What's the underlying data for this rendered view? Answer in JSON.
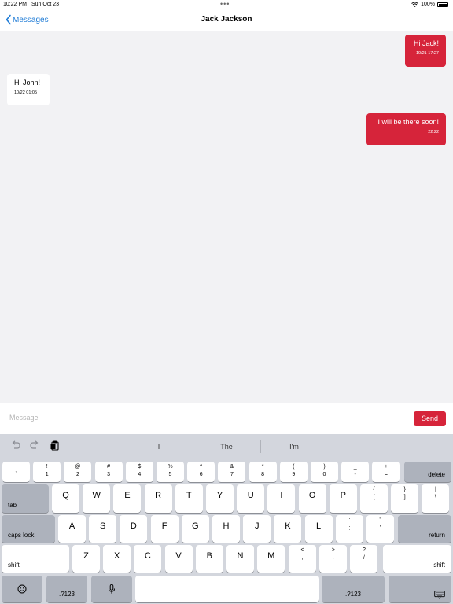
{
  "status_bar": {
    "time": "10:22 PM",
    "date": "Sun Oct 23",
    "dots": "•••",
    "battery": "100%"
  },
  "nav": {
    "back_label": "Messages",
    "title": "Jack Jackson"
  },
  "messages": [
    {
      "direction": "outgoing",
      "text": "Hi Jack!",
      "timestamp": "10/21 17:27"
    },
    {
      "direction": "incoming",
      "text": "Hi John!",
      "timestamp": "10/22 01:05"
    },
    {
      "direction": "outgoing",
      "text": "I will be there soon!",
      "timestamp": "22:22"
    }
  ],
  "composer": {
    "placeholder": "Message",
    "send_label": "Send"
  },
  "keyboard": {
    "suggestions": [
      "I",
      "The",
      "I'm"
    ],
    "number_row": [
      {
        "top": "~",
        "bottom": "`"
      },
      {
        "top": "!",
        "bottom": "1"
      },
      {
        "top": "@",
        "bottom": "2"
      },
      {
        "top": "#",
        "bottom": "3"
      },
      {
        "top": "$",
        "bottom": "4"
      },
      {
        "top": "%",
        "bottom": "5"
      },
      {
        "top": "^",
        "bottom": "6"
      },
      {
        "top": "&",
        "bottom": "7"
      },
      {
        "top": "*",
        "bottom": "8"
      },
      {
        "top": "(",
        "bottom": "9"
      },
      {
        "top": ")",
        "bottom": "0"
      },
      {
        "top": "_",
        "bottom": "-"
      },
      {
        "top": "+",
        "bottom": "="
      }
    ],
    "delete_label": "delete",
    "tab_label": "tab",
    "qwerty_row": [
      "Q",
      "W",
      "E",
      "R",
      "T",
      "Y",
      "U",
      "I",
      "O",
      "P"
    ],
    "qwerty_symbols": [
      {
        "top": "{",
        "bottom": "["
      },
      {
        "top": "}",
        "bottom": "]"
      },
      {
        "top": "|",
        "bottom": "\\"
      }
    ],
    "caps_label": "caps lock",
    "home_row": [
      "A",
      "S",
      "D",
      "F",
      "G",
      "H",
      "J",
      "K",
      "L"
    ],
    "home_symbols": [
      {
        "top": ":",
        "bottom": ";"
      },
      {
        "top": "\"",
        "bottom": "'"
      }
    ],
    "return_label": "return",
    "shift_label": "shift",
    "bottom_letters": [
      "Z",
      "X",
      "C",
      "V",
      "B",
      "N",
      "M"
    ],
    "bottom_symbols": [
      {
        "top": "<",
        "bottom": ","
      },
      {
        "top": ">",
        "bottom": "."
      },
      {
        "top": "?",
        "bottom": "/"
      }
    ],
    "numbers_label": ".?123",
    "icons": [
      "undo-icon",
      "redo-icon",
      "clipboard-icon",
      "emoji-icon",
      "microphone-icon",
      "keyboard-dismiss-icon"
    ]
  },
  "colors": {
    "accent": "#d6243a",
    "link": "#1e7bd6",
    "chat_bg": "#f2f2f4",
    "keyboard_bg": "#d3d6dd"
  }
}
